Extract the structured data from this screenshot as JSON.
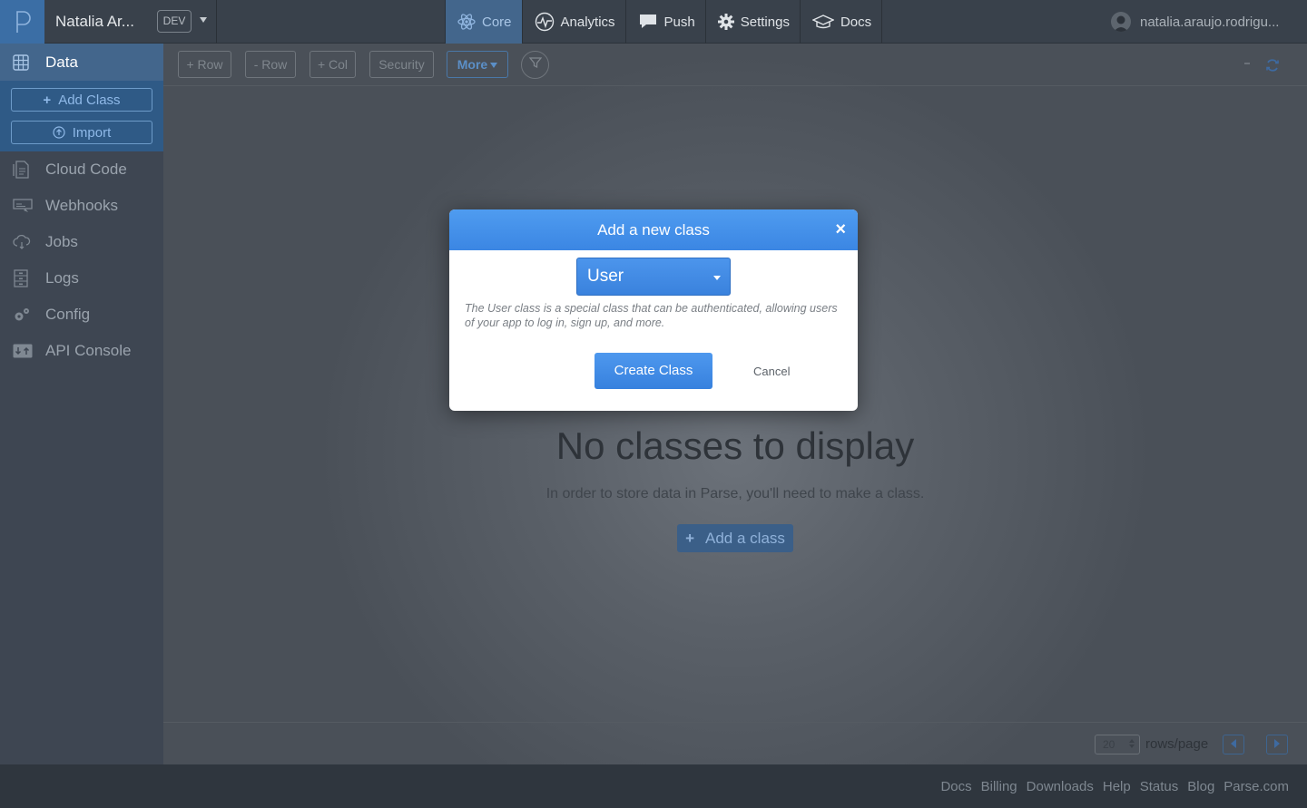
{
  "topbar": {
    "app_name": "Natalia Ar...",
    "env_label": "DEV",
    "nav": [
      {
        "label": "Core",
        "icon": "atom-icon",
        "active": true
      },
      {
        "label": "Analytics",
        "icon": "pulse-icon",
        "active": false
      },
      {
        "label": "Push",
        "icon": "chat-bubble-icon",
        "active": false
      },
      {
        "label": "Settings",
        "icon": "gear-icon",
        "active": false
      },
      {
        "label": "Docs",
        "icon": "graduation-cap-icon",
        "active": false
      }
    ],
    "user_name": "natalia.araujo.rodrigu..."
  },
  "sidebar": {
    "data_label": "Data",
    "add_class_label": "Add Class",
    "import_label": "Import",
    "items": [
      {
        "label": "Cloud Code",
        "icon": "document-icon"
      },
      {
        "label": "Webhooks",
        "icon": "webhook-icon"
      },
      {
        "label": "Jobs",
        "icon": "cloud-icon"
      },
      {
        "label": "Logs",
        "icon": "log-icon"
      },
      {
        "label": "Config",
        "icon": "gears-icon"
      },
      {
        "label": "API Console",
        "icon": "console-icon"
      }
    ]
  },
  "toolbar": {
    "add_row": "+ Row",
    "remove_row": "- Row",
    "add_col": "+ Col",
    "security": "Security",
    "more": "More"
  },
  "empty_state": {
    "title": "No classes to display",
    "subtitle": "In order to store data in Parse, you'll need to make a class.",
    "add_button": "Add a class"
  },
  "pagination": {
    "rows_per_page": "20",
    "rows_label": "rows/page"
  },
  "footer_links": [
    "Docs",
    "Billing",
    "Downloads",
    "Help",
    "Status",
    "Blog",
    "Parse.com"
  ],
  "modal": {
    "title": "Add a new class",
    "close_symbol": "×",
    "selected_class": "User",
    "description": "The User class is a special class that can be authenticated, allowing users of your app to log in, sign up, and more.",
    "create_label": "Create Class",
    "cancel_label": "Cancel"
  },
  "colors": {
    "accent_blue": "#3b86e3",
    "active_nav": "#43668c",
    "topbar": "#39414b",
    "sidebar": "#3e4652"
  }
}
